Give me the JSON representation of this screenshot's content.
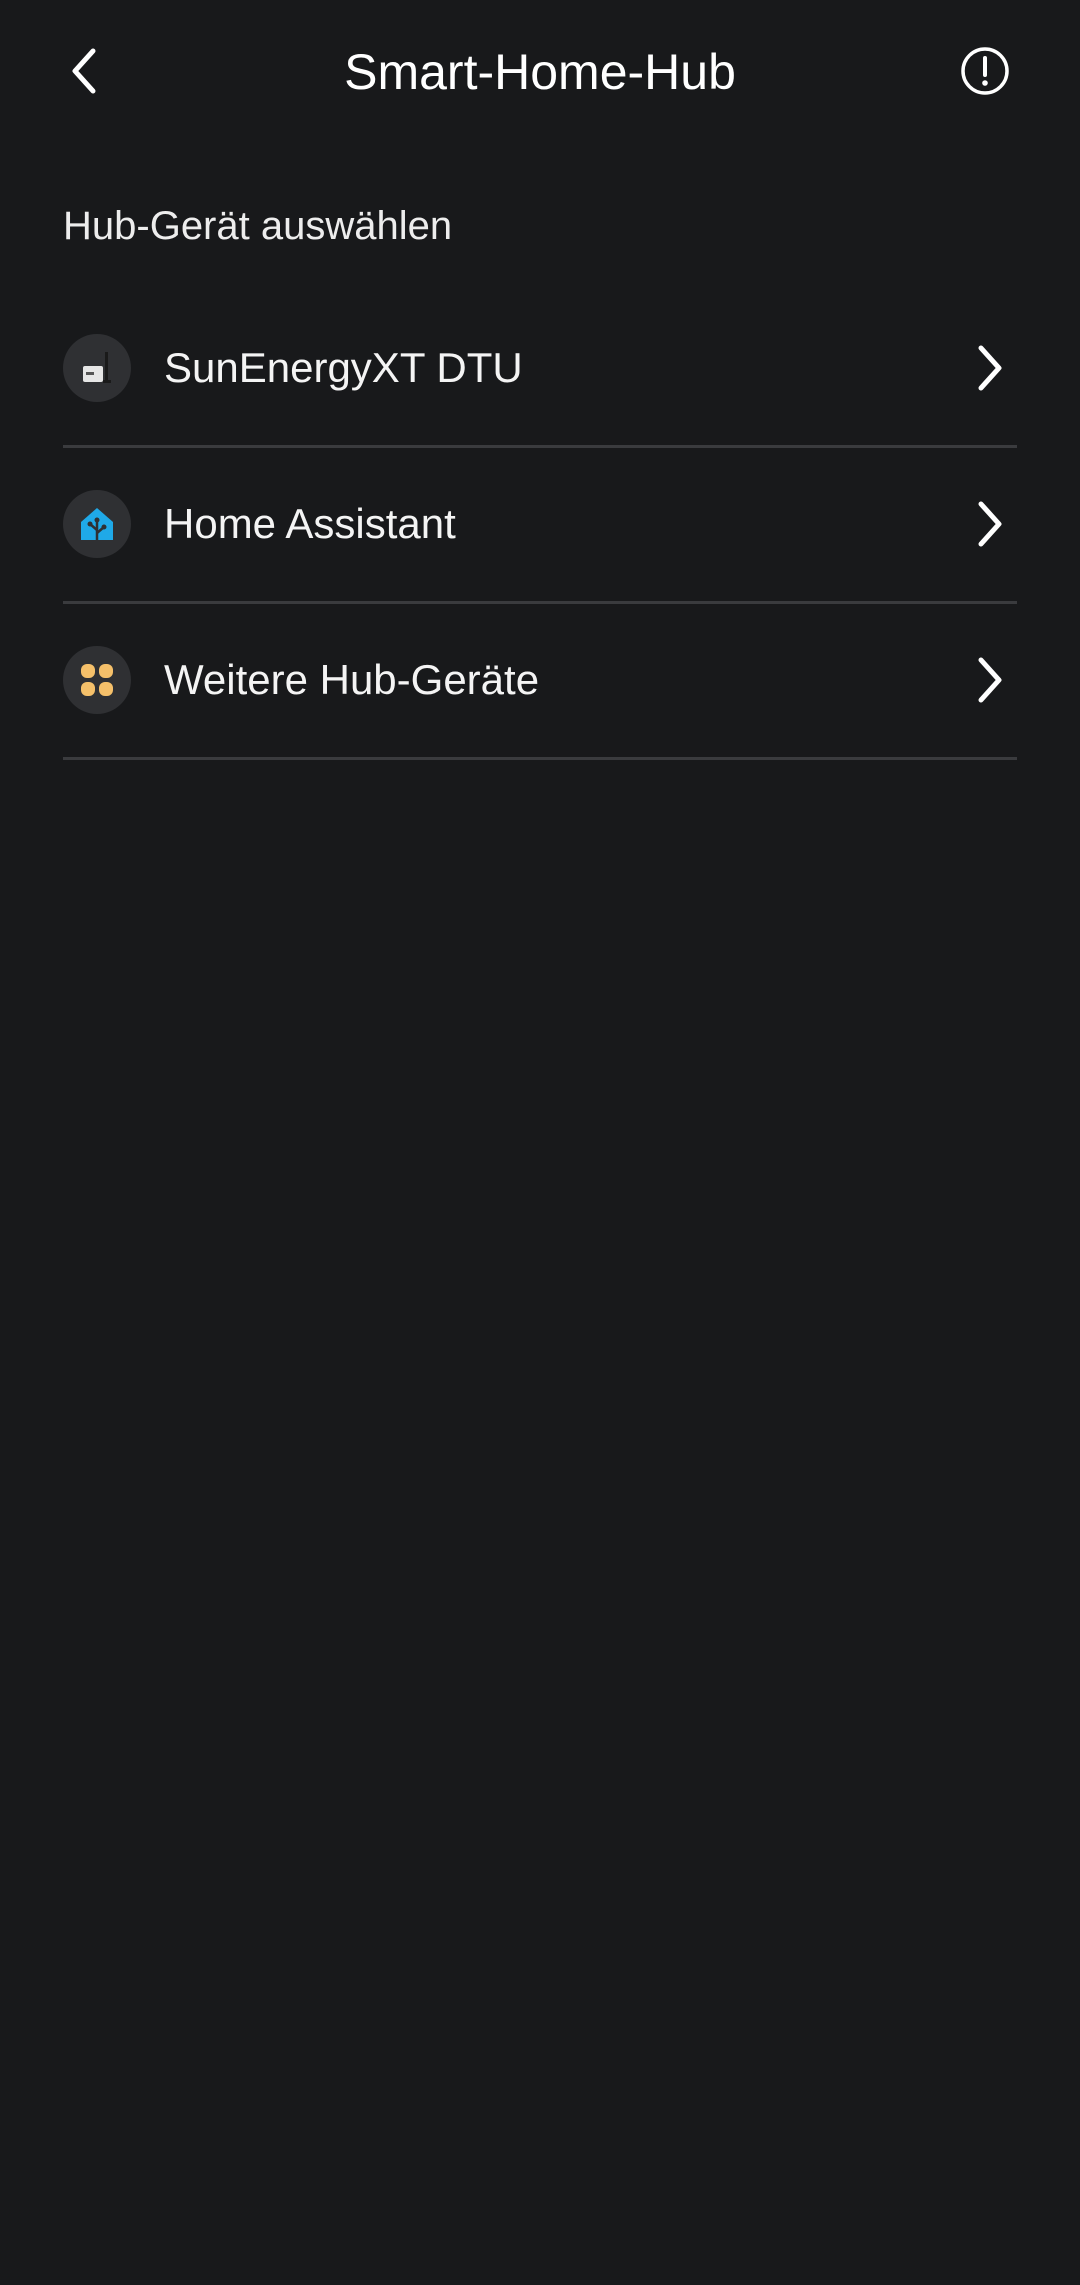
{
  "header": {
    "title": "Smart-Home-Hub",
    "back_icon": "back-arrow-icon",
    "info_icon": "info-circle-icon"
  },
  "section": {
    "title": "Hub-Gerät auswählen"
  },
  "items": [
    {
      "label": "SunEnergyXT DTU",
      "icon": "dtu-device-icon"
    },
    {
      "label": "Home Assistant",
      "icon": "home-assistant-icon",
      "accent": "#1fa9e8"
    },
    {
      "label": "Weitere Hub-Geräte",
      "icon": "more-devices-icon",
      "accent": "#f5c06a"
    }
  ],
  "colors": {
    "background": "#18191b",
    "divider": "#3a3b3e",
    "icon_bg": "#2f3033",
    "text": "#f4f4f4"
  }
}
